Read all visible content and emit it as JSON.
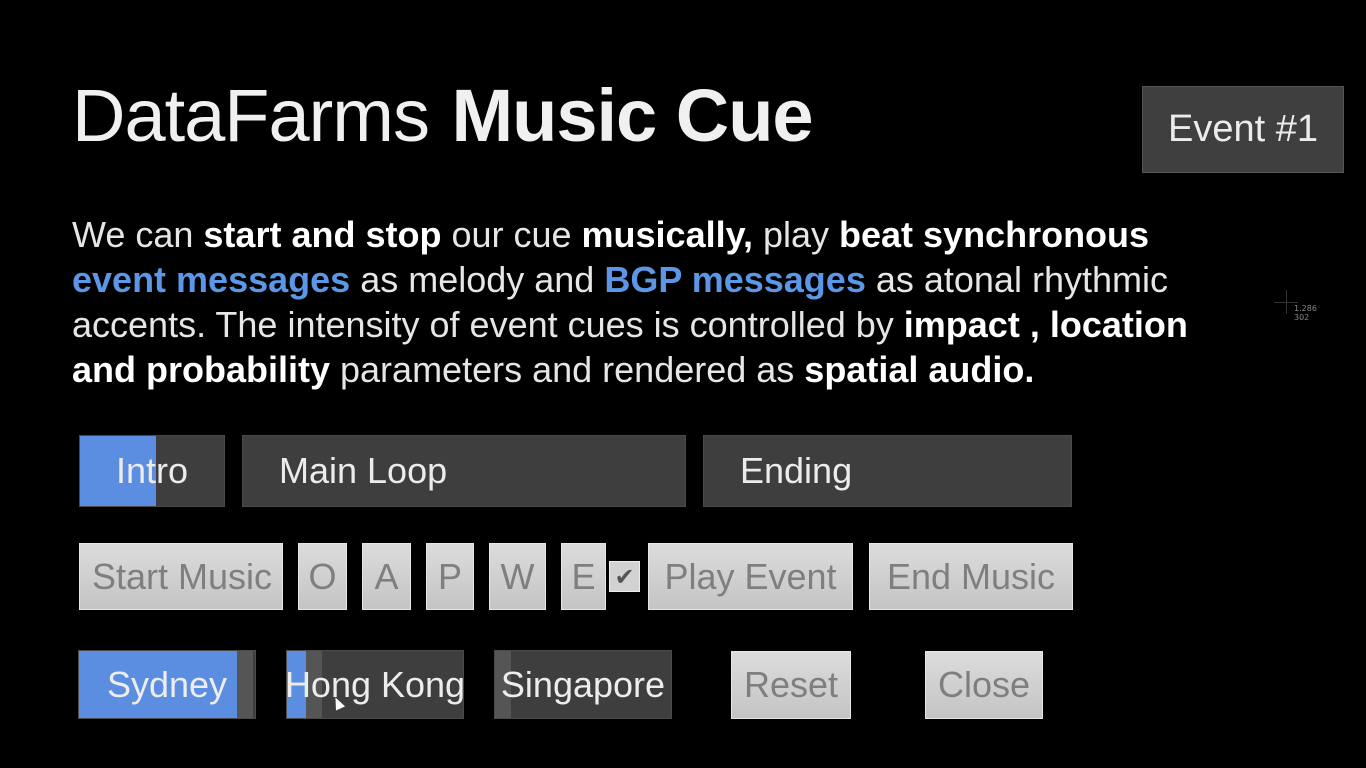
{
  "header": {
    "title_light": "DataFarms",
    "title_bold": "Music Cue",
    "event_badge": "Event #1"
  },
  "description": {
    "p1": "We can ",
    "b1": "start and stop",
    "p2": " our cue ",
    "b2": "musically,",
    "p3": " play ",
    "b3": "beat synchronous",
    "h1": "event messages",
    "p4": " as melody and ",
    "h2": "BGP messages",
    "p5": " as atonal rhythmic accents. The intensity of event cues is controlled by ",
    "b4": "impact , location and probability",
    "p6": " parameters and rendered as ",
    "b5": "spatial audio."
  },
  "cursor_readout": {
    "x": "1.286",
    "y": "302"
  },
  "segments": [
    {
      "label": "Intro",
      "progress": 0.53
    },
    {
      "label": "Main Loop",
      "progress": 0
    },
    {
      "label": "Ending",
      "progress": 0
    }
  ],
  "controls": {
    "start_music": "Start Music",
    "o": "O",
    "a": "A",
    "p": "P",
    "w": "W",
    "e": "E",
    "checkbox_checked": true,
    "checkmark": "✔",
    "play_event": "Play Event",
    "end_music": "End Music"
  },
  "cities": [
    {
      "label": "Sydney",
      "level": 0.9
    },
    {
      "label": "Hong Kong",
      "level": 0.11
    },
    {
      "label": "Singapore",
      "level": 0.0
    }
  ],
  "actions": {
    "reset": "Reset",
    "close": "Close"
  },
  "colors": {
    "accent": "#5b8ee0",
    "highlight_text": "#5b97e6",
    "background": "#000000"
  }
}
